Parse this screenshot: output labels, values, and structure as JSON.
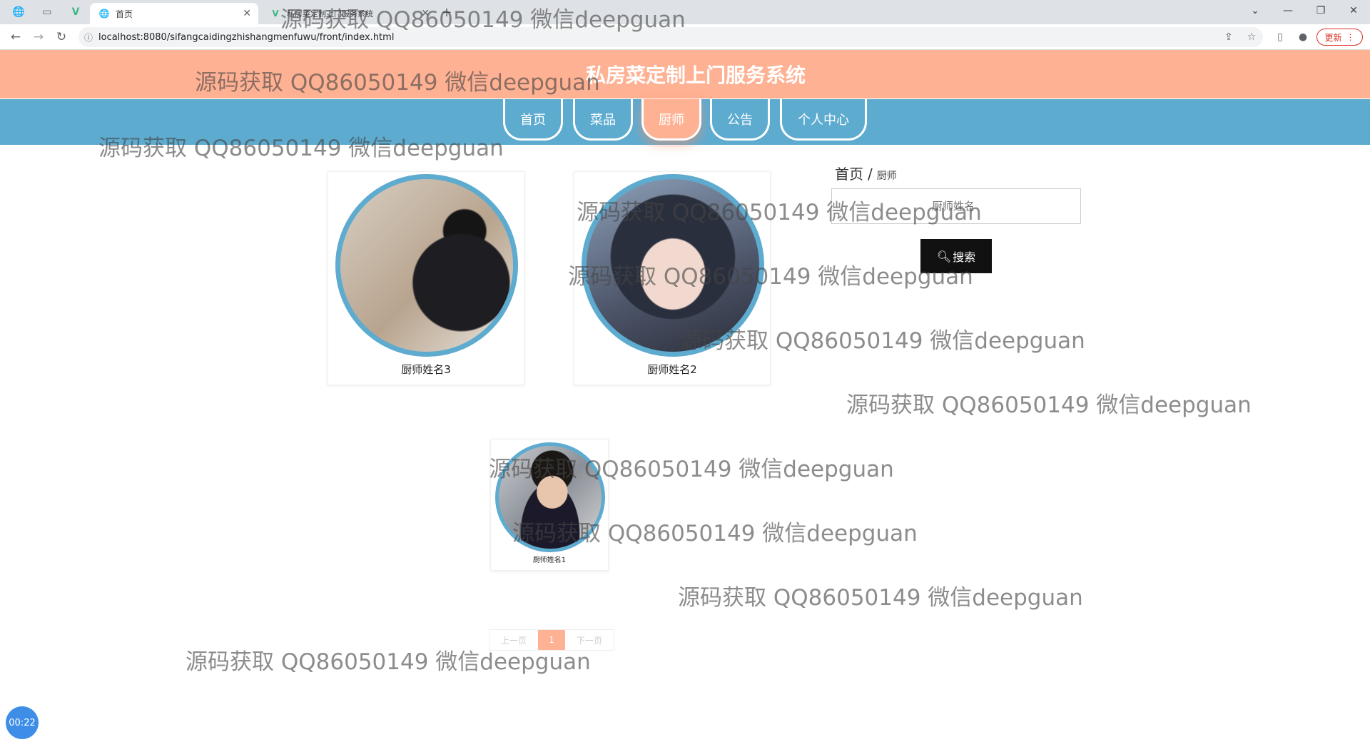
{
  "browser": {
    "tabs": [
      {
        "title": "首页",
        "active": true
      },
      {
        "title": "私房菜定制上门服务系统",
        "active": false
      }
    ],
    "url": "localhost:8080/sifangcaidingzhishangmenfuwu/front/index.html",
    "update_label": "更新"
  },
  "site": {
    "title": "私房菜定制上门服务系统",
    "nav": [
      "首页",
      "菜品",
      "厨师",
      "公告",
      "个人中心"
    ],
    "active_nav": "厨师"
  },
  "breadcrumb": {
    "home": "首页",
    "separator": "/",
    "current": "厨师"
  },
  "search": {
    "placeholder": "厨师姓名",
    "button_label": "搜索"
  },
  "chefs": [
    {
      "name": "厨师姓名3"
    },
    {
      "name": "厨师姓名2"
    },
    {
      "name": "厨师姓名1"
    }
  ],
  "pagination": {
    "prev": "上一页",
    "current": "1",
    "next": "下一页"
  },
  "timer": "00:22",
  "watermark": "源码获取 QQ86050149 微信deepguan",
  "colors": {
    "header": "#ffb193",
    "navbar": "#5eabd0",
    "search_button": "#111111"
  }
}
